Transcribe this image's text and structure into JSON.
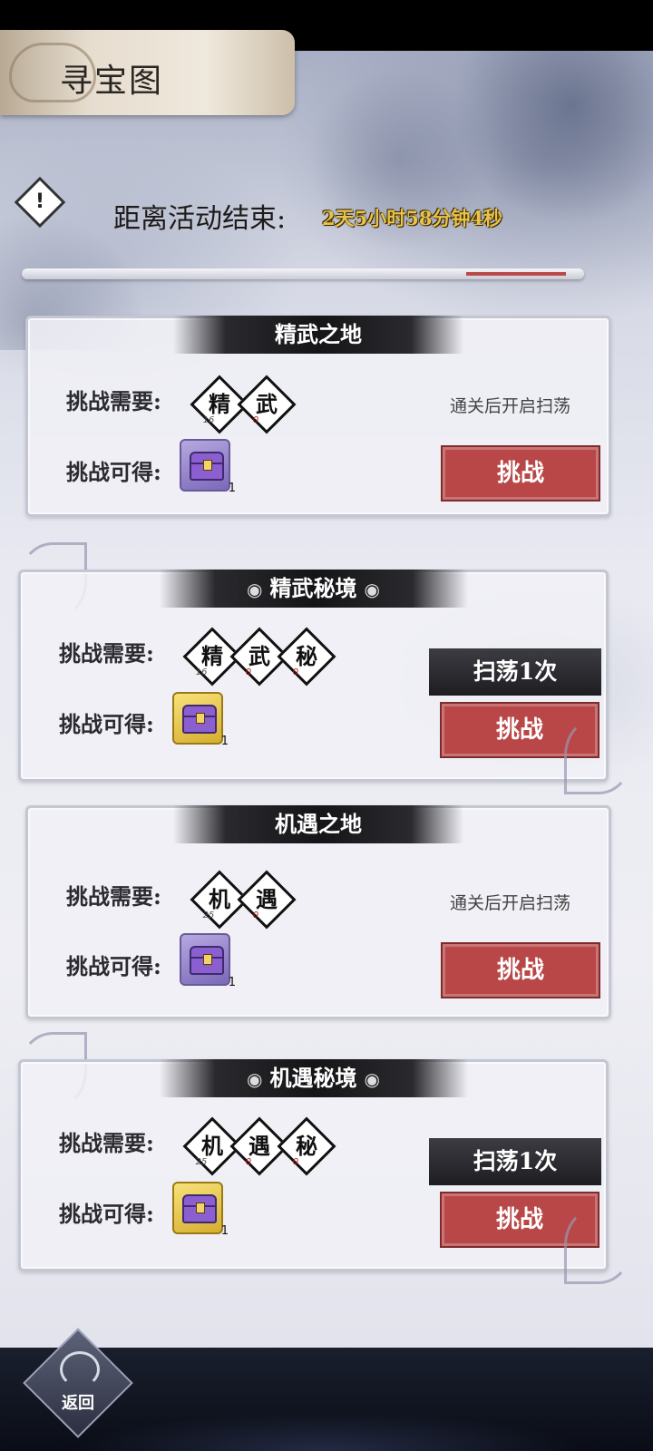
{
  "header": {
    "title": "寻宝图",
    "countdown_label": "距离活动结束:",
    "countdown_value": "2天5小时58分钟4秒",
    "info_icon": "!"
  },
  "labels": {
    "requirement": "挑战需要:",
    "reward": "挑战可得:",
    "challenge": "挑战",
    "sweep": "扫荡1次",
    "sweep_locked": "通关后开启扫荡",
    "swirl_left": "◉",
    "swirl_right": "◉"
  },
  "cards": [
    {
      "title": "精武之地",
      "tokens": [
        {
          "char": "精",
          "count": "16"
        },
        {
          "char": "武",
          "count": "0"
        }
      ],
      "reward_qty": "1"
    },
    {
      "title": "精武秘境",
      "tokens": [
        {
          "char": "精",
          "count": "16"
        },
        {
          "char": "武",
          "count": "0"
        },
        {
          "char": "秘",
          "count": "0"
        }
      ],
      "reward_qty": "1"
    },
    {
      "title": "机遇之地",
      "tokens": [
        {
          "char": "机",
          "count": "25"
        },
        {
          "char": "遇",
          "count": "0"
        }
      ],
      "reward_qty": "1"
    },
    {
      "title": "机遇秘境",
      "tokens": [
        {
          "char": "机",
          "count": "25"
        },
        {
          "char": "遇",
          "count": "0"
        },
        {
          "char": "秘",
          "count": "0"
        }
      ],
      "reward_qty": "1"
    }
  ],
  "footer": {
    "back_label": "返回"
  },
  "colors": {
    "accent_red": "#b94747",
    "countdown_gold": "#e8c24a",
    "sweep_dark": "#1d1d22"
  },
  "icons": {
    "info": "alert-diamond-icon",
    "chest": "treasure-chest-icon",
    "back": "cloud-swirl-icon"
  }
}
